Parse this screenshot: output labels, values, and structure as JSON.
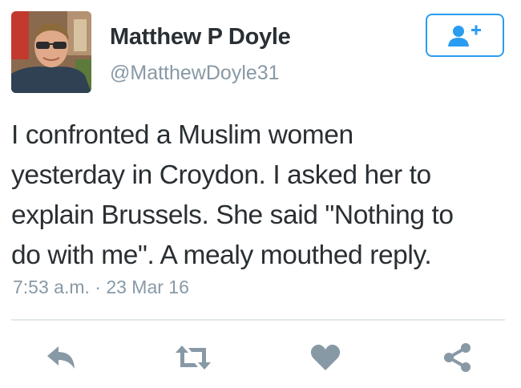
{
  "author": {
    "display_name": "Matthew P Doyle",
    "handle": "@MatthewDoyle31",
    "avatar_icon": "profile-photo"
  },
  "follow_button": {
    "icon": "add-user-icon",
    "color": "#2b9df0"
  },
  "tweet": {
    "lines": [
      "I confronted a Muslim women",
      "yesterday in Croydon. I asked her to",
      "explain Brussels. She said \"Nothing to",
      "do with me\". A mealy mouthed reply."
    ],
    "timestamp": "7:53 a.m. · 23 Mar 16"
  },
  "actions": [
    {
      "name": "reply",
      "icon": "reply-icon"
    },
    {
      "name": "retweet",
      "icon": "retweet-icon"
    },
    {
      "name": "like",
      "icon": "heart-icon"
    },
    {
      "name": "share",
      "icon": "share-icon"
    }
  ],
  "colors": {
    "text": "#292f33",
    "secondary_text": "#8899a6",
    "action_icon": "#8899a6",
    "accent": "#2b9df0",
    "divider": "#e1e8ed"
  }
}
